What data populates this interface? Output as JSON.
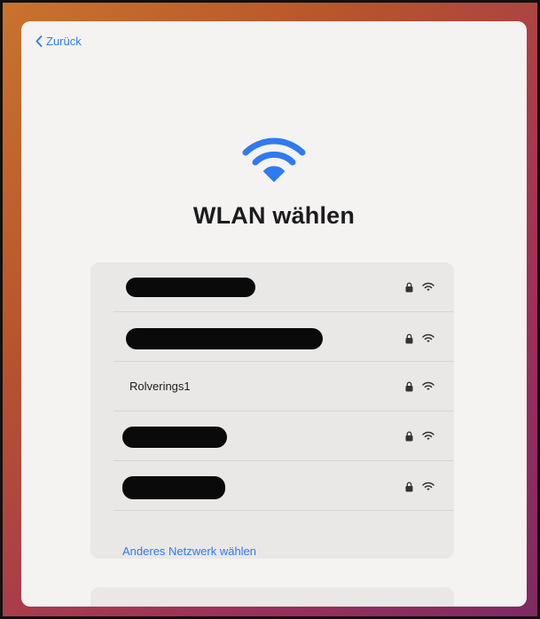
{
  "nav": {
    "back_label": "Zurück"
  },
  "header": {
    "title": "WLAN wählen"
  },
  "networks": [
    {
      "label": "",
      "redacted": true,
      "secured": true
    },
    {
      "label": "",
      "redacted": true,
      "secured": true
    },
    {
      "label": "Rolverings1",
      "redacted": false,
      "secured": true
    },
    {
      "label": "",
      "redacted": true,
      "secured": true
    },
    {
      "label": "",
      "redacted": true,
      "secured": true
    }
  ],
  "other_network_label": "Anderes Netzwerk wählen",
  "colors": {
    "accent": "#2f7af0",
    "sheet": "#f4f3f1",
    "card": "#e9e8e6"
  },
  "icons": [
    "chevron-left-icon",
    "wifi-icon",
    "lock-icon"
  ]
}
